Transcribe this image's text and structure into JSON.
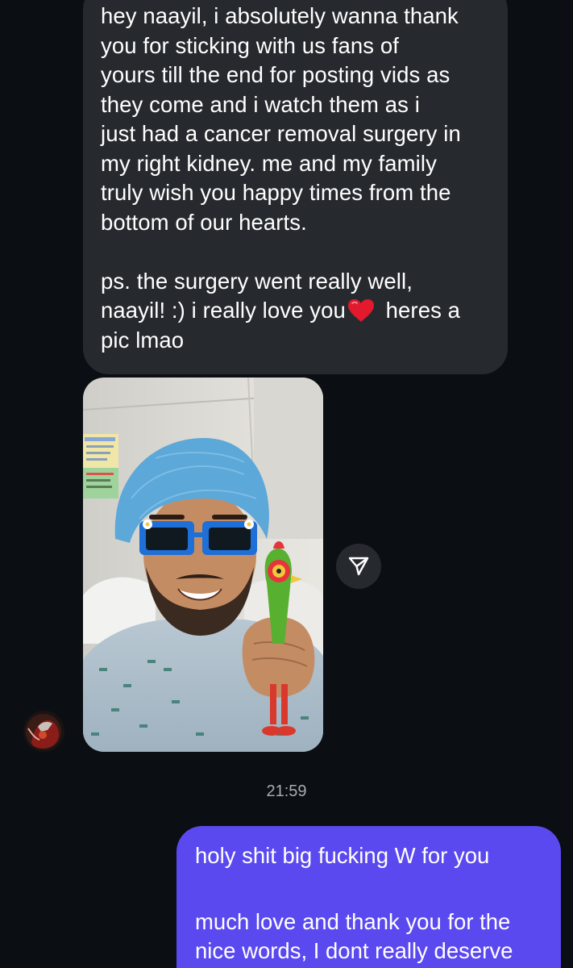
{
  "messages": {
    "received": {
      "lines": [
        "hey naayil, i absolutely wanna thank",
        "you for sticking with us fans of",
        "yours till the end for posting vids as",
        "they come and i watch them as i",
        "just had a cancer removal surgery in",
        "my right kidney. me and my family",
        "truly wish you happy times from the",
        "bottom of our hearts."
      ],
      "ps_line1": "ps. the surgery went really well,",
      "ps_line2_before": "naayil! :) i really love you",
      "ps_line2_after": " heres a",
      "ps_line3": "pic lmao",
      "heart_icon": "red-heart-emoji",
      "photo_icon": "hospital-selfie-photo"
    },
    "timestamp": "21:59",
    "sent": {
      "line1": "holy shit big fucking W for you",
      "line2": "much love and thank you for the",
      "line3": "nice words, I dont really deserve"
    }
  },
  "share_icon": "send-arrow-icon",
  "colors": {
    "background": "#0b0f14",
    "received_bubble": "#262a2f",
    "sent_bubble": "#5b49f0",
    "timestamp": "#a8acb2"
  }
}
